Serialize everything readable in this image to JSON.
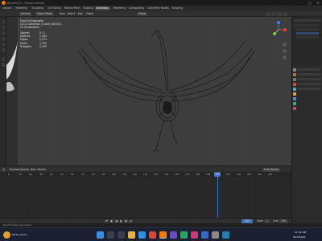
{
  "window": {
    "title": "Blender [F:\\...\\Phoenix.blend]"
  },
  "workspaces": [
    "Layout",
    "Modeling",
    "Sculpting",
    "UV Editing",
    "Texture Paint",
    "Shading",
    "Animation",
    "Rendering",
    "Compositing",
    "Geometry Nodes",
    "Scripting"
  ],
  "active_workspace": "Animation",
  "header": {
    "editor_type": "Camera",
    "mode": "Object Mode",
    "menus": [
      "View",
      "Select",
      "Add",
      "Object"
    ],
    "transform": "Global"
  },
  "viewport": {
    "overlay": {
      "view": "Front Orthographic",
      "collection": "(211) Collection | Crane_K16.001",
      "units": "10 Centimeters"
    },
    "stats": [
      {
        "label": "Objects",
        "value": "0 / 1"
      },
      {
        "label": "Vertices",
        "value": "1,164"
      },
      {
        "label": "Edges",
        "value": "2,073"
      },
      {
        "label": "Faces",
        "value": "2,195"
      },
      {
        "label": "Triangles",
        "value": "2,195"
      }
    ],
    "gizmo": {
      "x_color": "#e0463f",
      "y_color": "#8ac437",
      "z_color": "#3f7ef0"
    }
  },
  "timeline": {
    "menus": [
      "Playback",
      "Keying",
      "View",
      "Marker"
    ],
    "keying_label": "Auto Keying",
    "ticks": [
      "0",
      "10",
      "20",
      "30",
      "40",
      "50",
      "60",
      "70",
      "80",
      "90",
      "100",
      "110",
      "120",
      "130",
      "140",
      "150",
      "160",
      "170",
      "180",
      "190",
      "200",
      "210",
      "220",
      "230",
      "240",
      "250"
    ],
    "current_frame": "211",
    "start": "1",
    "end": "250",
    "start_label": "Start",
    "end_label": "End"
  },
  "statusbar": {
    "left": "Select    Rotate View    Object"
  },
  "taskbar": {
    "weather": "Partly sunny",
    "time": "11:42 AM",
    "date": "6/15/2024"
  },
  "colors": {
    "accent": "#4772b3",
    "blender_orange": "#e87d0d"
  }
}
